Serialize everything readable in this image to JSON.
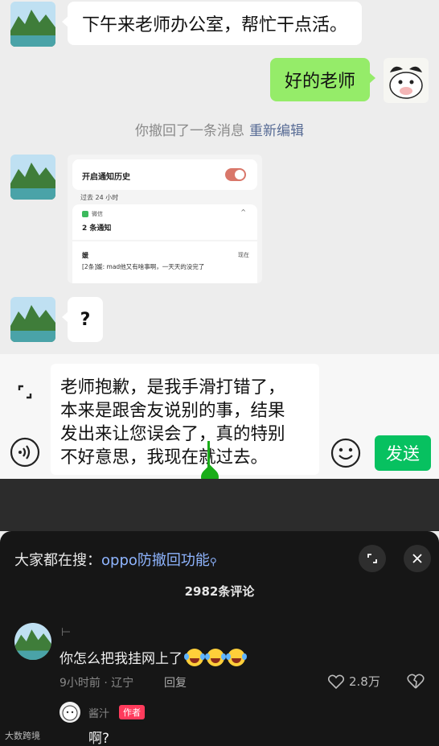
{
  "chat": {
    "messages": [
      {
        "side": "left",
        "text": "下午来老师办公室，帮忙干点活。"
      },
      {
        "side": "right",
        "text": "好的老师"
      },
      {
        "side": "left",
        "text": "?"
      }
    ],
    "recall_notice": "你撤回了一条消息",
    "recall_edit": "重新编辑",
    "notification_screenshot": {
      "title": "开启通知历史",
      "past": "过去 24 小时",
      "app": "微信",
      "count": "2 条通知",
      "sender": "媛",
      "time": "现在",
      "body": "[2条]媛: mad他又有啥事啊，一天天的没完了"
    }
  },
  "input": {
    "text": "老师抱歉，是我手滑打错了，\n本来是跟舍友说别的事，结果\n发出来让您误会了，真的特别\n不好意思，我现在就过去。",
    "send_label": "发送"
  },
  "comments_panel": {
    "search_prefix": "大家都在搜：",
    "search_keyword": "oppo防撤回功能",
    "count": "2982条评论",
    "comment": {
      "user": "⊢",
      "text": "你怎么把我挂网上了",
      "time_location": "9小时前 · 辽宁",
      "reply": "回复",
      "likes": "2.8万"
    },
    "reply": {
      "user": "酱汁",
      "badge": "作者",
      "text": "啊?"
    },
    "watermark": "大数跨境"
  },
  "colors": {
    "chat_bg": "#ededed",
    "bubble_green": "#95ec69",
    "send_green": "#07c160",
    "panel_bg": "#161616",
    "link_blue": "#576b95"
  }
}
